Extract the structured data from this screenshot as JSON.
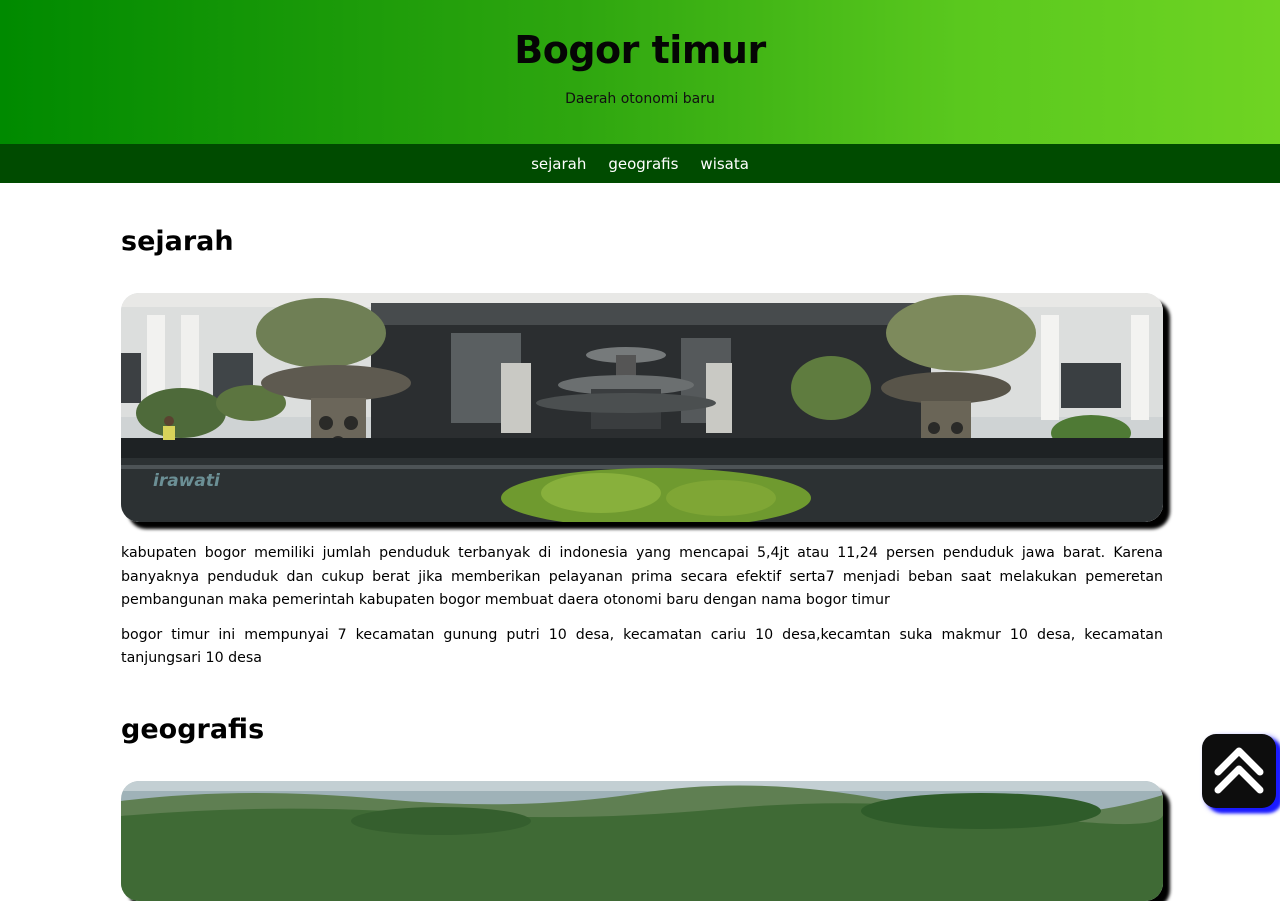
{
  "header": {
    "title": "Bogor timur",
    "subtitle": "Daerah otonomi baru"
  },
  "nav": {
    "items": [
      "sejarah",
      "geografis",
      "wisata"
    ]
  },
  "sections": {
    "sejarah": {
      "title": "sejarah",
      "image_overlay_text": "irawati",
      "paragraphs": [
        "kabupaten bogor memiliki jumlah penduduk terbanyak di indonesia yang mencapai 5,4jt atau 11,24 persen penduduk jawa barat. Karena banyaknya penduduk dan cukup berat jika memberikan pelayanan prima secara efektif serta7 menjadi beban saat melakukan pemeretan pembangunan maka pemerintah kabupaten bogor membuat daera otonomi baru dengan nama bogor timur",
        "bogor timur ini mempunyai 7 kecamatan gunung putri 10 desa, kecamatan cariu 10 desa,kecamtan suka makmur 10 desa, kecamatan tanjungsari 10 desa"
      ]
    },
    "geografis": {
      "title": "geografis"
    }
  },
  "icons": {
    "back_to_top": "double-chevron-up-icon"
  },
  "colors": {
    "header_gradient_start": "#008a00",
    "header_gradient_end": "#6fd423",
    "navbar": "#004b00",
    "back_to_top_bg": "#0d0d0d",
    "back_to_top_shadow": "#1a1aff"
  }
}
